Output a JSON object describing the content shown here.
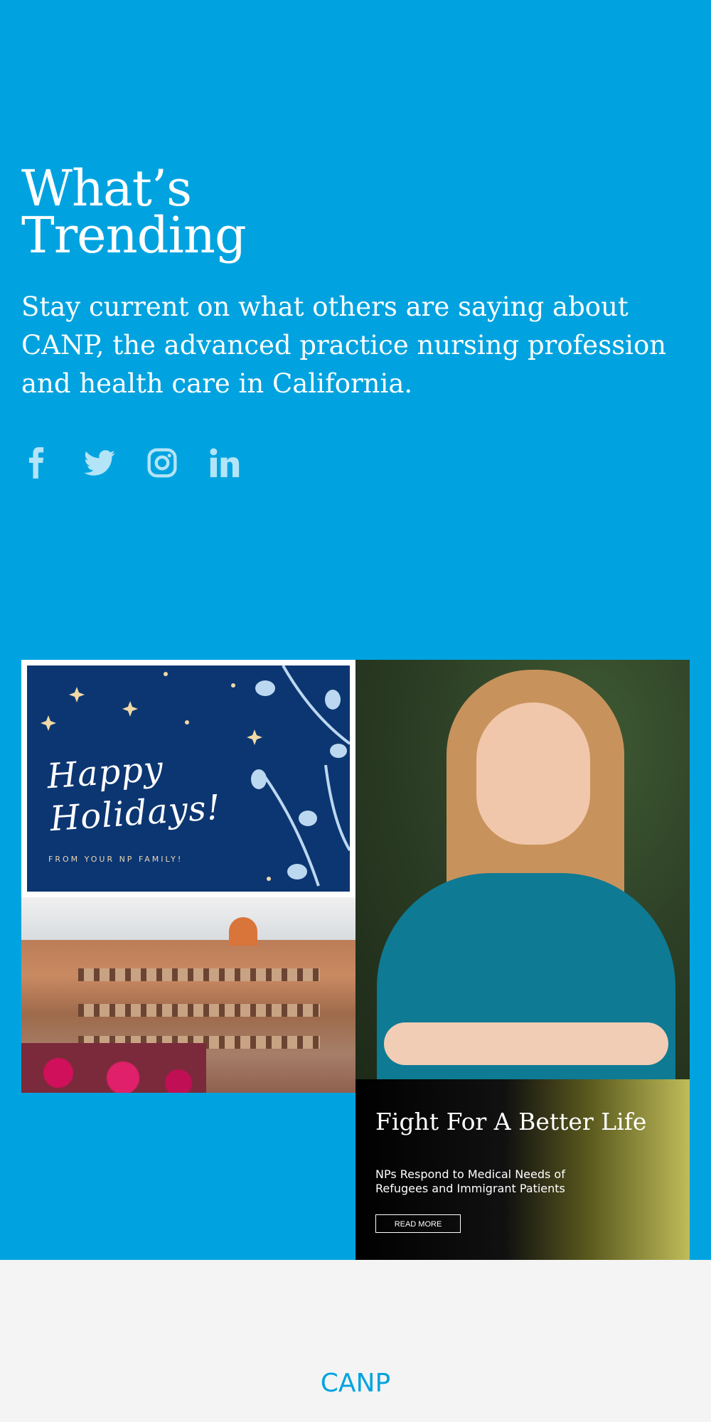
{
  "section": {
    "title_line1": "What’s",
    "title_line2": "Trending",
    "description": "Stay current on what others are saying about CANP, the advanced practice nursing profession and health care in California."
  },
  "social": [
    {
      "name": "facebook-icon"
    },
    {
      "name": "twitter-icon"
    },
    {
      "name": "instagram-icon"
    },
    {
      "name": "linkedin-icon"
    }
  ],
  "tiles": {
    "holiday": {
      "line1": "Happy",
      "line2": "Holidays!",
      "sub": "FROM YOUR NP FAMILY!"
    },
    "fight": {
      "title": "Fight For A Better Life",
      "subtitle": "NPs Respond to Medical Needs of Refugees and Immigrant Patients",
      "button": "READ MORE"
    }
  },
  "footer": {
    "brand": "CANP"
  },
  "colors": {
    "brand_blue": "#00a3df",
    "navy": "#0c3672",
    "footer_bg": "#f4f4f4"
  }
}
